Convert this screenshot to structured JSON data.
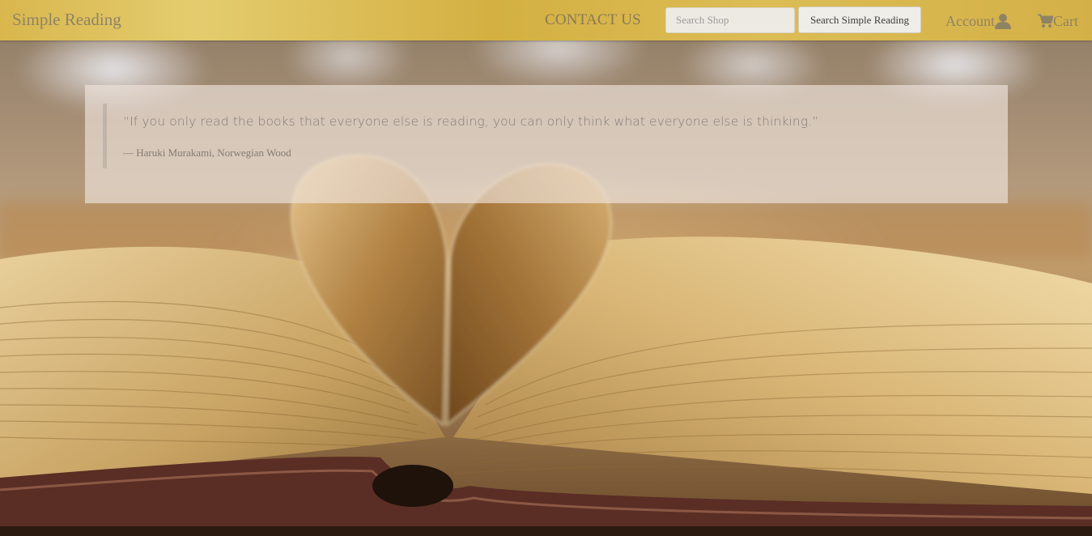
{
  "navbar": {
    "brand": "Simple Reading",
    "contact_label": "CONTACT US",
    "search": {
      "placeholder": "Search Shop",
      "value": "",
      "button_label": "Search Simple Reading"
    },
    "account": {
      "label": "Account",
      "icon": "user-icon"
    },
    "cart": {
      "label": "Cart",
      "icon": "cart-icon"
    }
  },
  "quote": {
    "text": "“If you only read the books that everyone else is reading, you can only think what everyone else is thinking.”",
    "citation": "— Haruki Murakami, Norwegian Wood"
  },
  "colors": {
    "navbar": "#d9b74e",
    "nav_text": "#8f8365",
    "quote_panel": "#eee4dc",
    "quote_text": "#857b76"
  },
  "background": {
    "image": "open book with pages folded into a heart"
  }
}
